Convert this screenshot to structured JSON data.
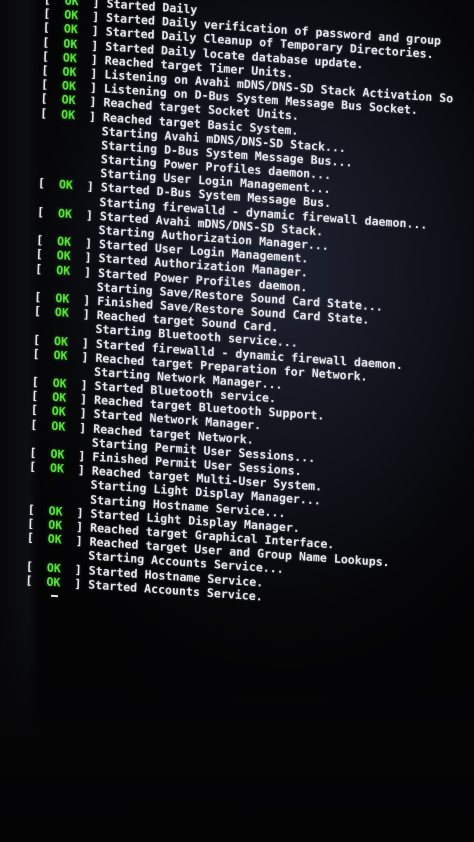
{
  "ok_label": "OK",
  "lines": [
    {
      "ok": true,
      "text": "Started Daily"
    },
    {
      "ok": true,
      "text": "Started Daily verification of password and group"
    },
    {
      "ok": true,
      "text": "Started Daily Cleanup of Temporary Directories."
    },
    {
      "ok": true,
      "text": "Started Daily locate database update."
    },
    {
      "ok": true,
      "text": "Reached target Timer Units."
    },
    {
      "ok": true,
      "text": "Listening on Avahi mDNS/DNS-SD Stack Activation So"
    },
    {
      "ok": true,
      "text": "Listening on D-Bus System Message Bus Socket."
    },
    {
      "ok": true,
      "text": "Reached target Socket Units."
    },
    {
      "ok": true,
      "text": "Reached target Basic System."
    },
    {
      "ok": false,
      "text": "Starting Avahi mDNS/DNS-SD Stack..."
    },
    {
      "ok": false,
      "text": "Starting D-Bus System Message Bus..."
    },
    {
      "ok": false,
      "text": "Starting Power Profiles daemon..."
    },
    {
      "ok": false,
      "text": "Starting User Login Management..."
    },
    {
      "ok": true,
      "text": "Started D-Bus System Message Bus."
    },
    {
      "ok": false,
      "text": "Starting firewalld - dynamic firewall daemon..."
    },
    {
      "ok": true,
      "text": "Started Avahi mDNS/DNS-SD Stack."
    },
    {
      "ok": false,
      "text": "Starting Authorization Manager..."
    },
    {
      "ok": true,
      "text": "Started User Login Management."
    },
    {
      "ok": true,
      "text": "Started Authorization Manager."
    },
    {
      "ok": true,
      "text": "Started Power Profiles daemon."
    },
    {
      "ok": false,
      "text": "Starting Save/Restore Sound Card State..."
    },
    {
      "ok": true,
      "text": "Finished Save/Restore Sound Card State."
    },
    {
      "ok": true,
      "text": "Reached target Sound Card."
    },
    {
      "ok": false,
      "text": "Starting Bluetooth service..."
    },
    {
      "ok": true,
      "text": "Started firewalld - dynamic firewall daemon."
    },
    {
      "ok": true,
      "text": "Reached target Preparation for Network."
    },
    {
      "ok": false,
      "text": "Starting Network Manager..."
    },
    {
      "ok": true,
      "text": "Started Bluetooth service."
    },
    {
      "ok": true,
      "text": "Reached target Bluetooth Support."
    },
    {
      "ok": true,
      "text": "Started Network Manager."
    },
    {
      "ok": true,
      "text": "Reached target Network."
    },
    {
      "ok": false,
      "text": "Starting Permit User Sessions..."
    },
    {
      "ok": true,
      "text": "Finished Permit User Sessions."
    },
    {
      "ok": true,
      "text": "Reached target Multi-User System."
    },
    {
      "ok": false,
      "text": "Starting Light Display Manager..."
    },
    {
      "ok": false,
      "text": "Starting Hostname Service..."
    },
    {
      "ok": true,
      "text": "Started Light Display Manager."
    },
    {
      "ok": true,
      "text": "Reached target Graphical Interface."
    },
    {
      "ok": true,
      "text": "Reached target User and Group Name Lookups."
    },
    {
      "ok": false,
      "text": "Starting Accounts Service..."
    },
    {
      "ok": true,
      "text": "Started Hostname Service."
    },
    {
      "ok": true,
      "text": "Started Accounts Service."
    }
  ],
  "colors": {
    "ok_green": "#58e23a",
    "text": "#e6e6ea",
    "screen_bg": "#10121a"
  }
}
